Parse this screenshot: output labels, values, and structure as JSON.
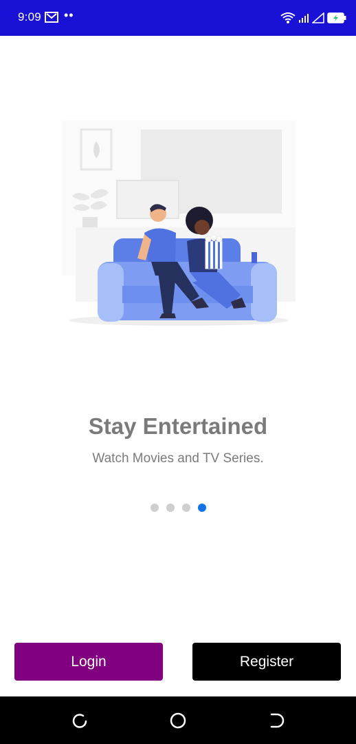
{
  "status_bar": {
    "time": "9:09",
    "notification_dots": "••",
    "background_color": "#1a11d6"
  },
  "onboarding": {
    "illustration_icon": "couple-watching-tv-illustration",
    "title": "Stay Entertained",
    "subtitle": "Watch Movies and TV Series.",
    "page_count": 4,
    "active_page": 4,
    "accent_color": "#1273e8"
  },
  "actions": {
    "login_label": "Login",
    "login_color": "#800080",
    "register_label": "Register",
    "register_color": "#000000"
  },
  "nav_bar": {
    "icons": [
      "recent-apps-icon",
      "home-icon",
      "back-icon"
    ]
  }
}
